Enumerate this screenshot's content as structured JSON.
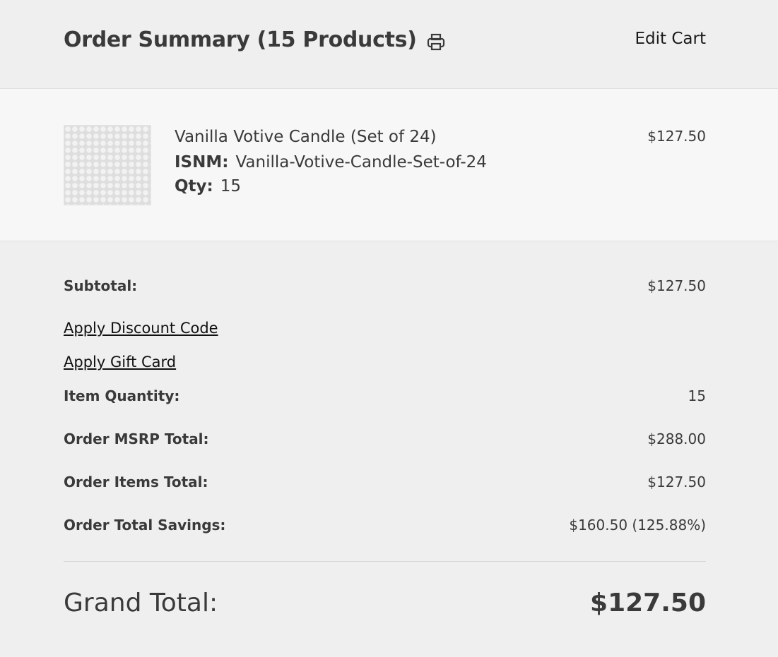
{
  "header": {
    "title": "Order Summary (15 Products)",
    "print_icon": "printer-icon",
    "edit_cart_label": "Edit Cart"
  },
  "product": {
    "name": "Vanilla Votive Candle (Set of 24)",
    "isnm_label": "ISNM:",
    "isnm_value": "Vanilla-Votive-Candle-Set-of-24",
    "qty_label": "Qty:",
    "qty_value": "15",
    "price": "$127.50"
  },
  "totals": {
    "subtotal_label": "Subtotal:",
    "subtotal_value": "$127.50",
    "discount_link": "Apply Discount Code",
    "gift_card_link": "Apply Gift Card",
    "item_qty_label": "Item Quantity:",
    "item_qty_value": "15",
    "msrp_label": "Order MSRP Total:",
    "msrp_value": "$288.00",
    "items_total_label": "Order Items Total:",
    "items_total_value": "$127.50",
    "savings_label": "Order Total Savings:",
    "savings_value": "$160.50 (125.88%)",
    "grand_total_label": "Grand Total:",
    "grand_total_value": "$127.50"
  }
}
